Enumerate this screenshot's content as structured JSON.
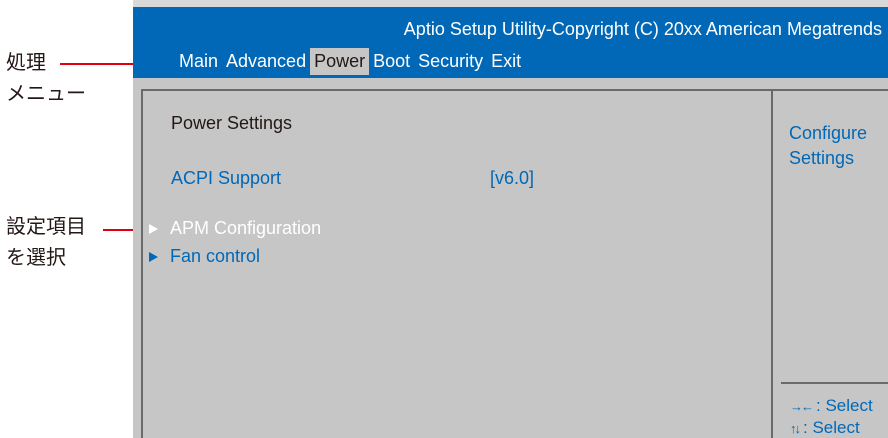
{
  "annotations": {
    "menu": {
      "line1": "処理",
      "line2": "メニュー"
    },
    "item": {
      "line1": "設定項目",
      "line2": "を選択"
    },
    "leader_color": "#e00012"
  },
  "bios": {
    "title": "Aptio Setup Utility-Copyright (C) 20xx American Megatrends",
    "menu": [
      {
        "label": "Main",
        "active": false
      },
      {
        "label": "Advanced",
        "active": false
      },
      {
        "label": "Power",
        "active": true
      },
      {
        "label": "Boot",
        "active": false
      },
      {
        "label": "Security",
        "active": false
      },
      {
        "label": "Exit",
        "active": false
      }
    ],
    "section_title": "Power  Settings",
    "acpi": {
      "label": "ACPI Support",
      "value": "[v6.0]"
    },
    "submenus": [
      {
        "label": "APM Configuration",
        "selected": true
      },
      {
        "label": "Fan control",
        "selected": false
      }
    ],
    "help": "Configure\nSettings",
    "keys": [
      {
        "icon": "left-right-arrows-icon",
        "glyph": "→←",
        "text": ": Select"
      },
      {
        "icon": "up-down-arrows-icon",
        "glyph": "↑↓",
        "text": ": Select"
      }
    ],
    "colors": {
      "header_blue": "#0068b7",
      "screen_gray": "#c6c6c6",
      "text_dark": "#231815"
    }
  }
}
